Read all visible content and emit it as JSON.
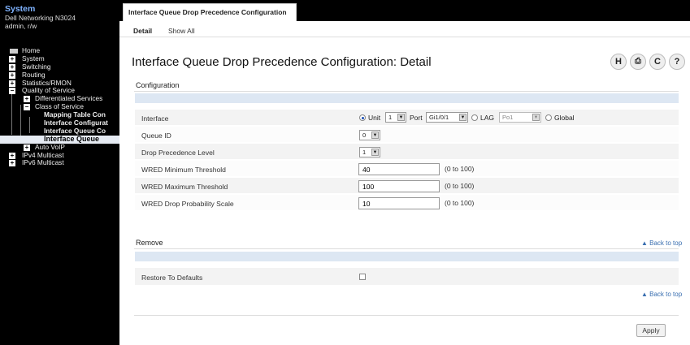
{
  "system": {
    "title": "System",
    "device": "Dell Networking N3024",
    "user": "admin, r/w"
  },
  "nav": {
    "items": [
      {
        "label": "Home"
      },
      {
        "label": "System"
      },
      {
        "label": "Switching"
      },
      {
        "label": "Routing"
      },
      {
        "label": "Statistics/RMON"
      },
      {
        "label": "Quality of Service"
      },
      {
        "label": "Differentiated Services"
      },
      {
        "label": "Class of Service"
      },
      {
        "label": "Mapping Table Con"
      },
      {
        "label": "Interface Configurat"
      },
      {
        "label": "Interface Queue Co"
      },
      {
        "label": "Interface Queue"
      },
      {
        "label": "Auto VoIP"
      },
      {
        "label": "IPv4 Multicast"
      },
      {
        "label": "IPv6 Multicast"
      }
    ]
  },
  "header": {
    "tab_title": "Interface Queue Drop Precedence Configuration",
    "subtabs": [
      "Detail",
      "Show All"
    ]
  },
  "page": {
    "title": "Interface Queue Drop Precedence Configuration: Detail",
    "toolbar": {
      "help": "H",
      "print": "⎙",
      "refresh": "C",
      "question": "?"
    }
  },
  "configuration": {
    "section_title": "Configuration",
    "interface": {
      "label": "Interface",
      "unit_label": "Unit",
      "unit_value": "1",
      "port_label": "Port",
      "port_value": "Gi1/0/1",
      "lag_label": "LAG",
      "lag_value": "Po1",
      "global_label": "Global"
    },
    "queue_id": {
      "label": "Queue ID",
      "value": "0"
    },
    "drop_precedence": {
      "label": "Drop Precedence Level",
      "value": "1"
    },
    "wred_min": {
      "label": "WRED Minimum Threshold",
      "value": "40",
      "range": "(0 to 100)"
    },
    "wred_max": {
      "label": "WRED Maximum Threshold",
      "value": "100",
      "range": "(0 to 100)"
    },
    "wred_prob": {
      "label": "WRED Drop Probability Scale",
      "value": "10",
      "range": "(0 to 100)"
    }
  },
  "remove": {
    "section_title": "Remove",
    "back_to_top": "▲ Back to top",
    "restore_label": "Restore To Defaults",
    "back_to_top_bottom": "▲ Back to top"
  },
  "apply_label": "Apply"
}
